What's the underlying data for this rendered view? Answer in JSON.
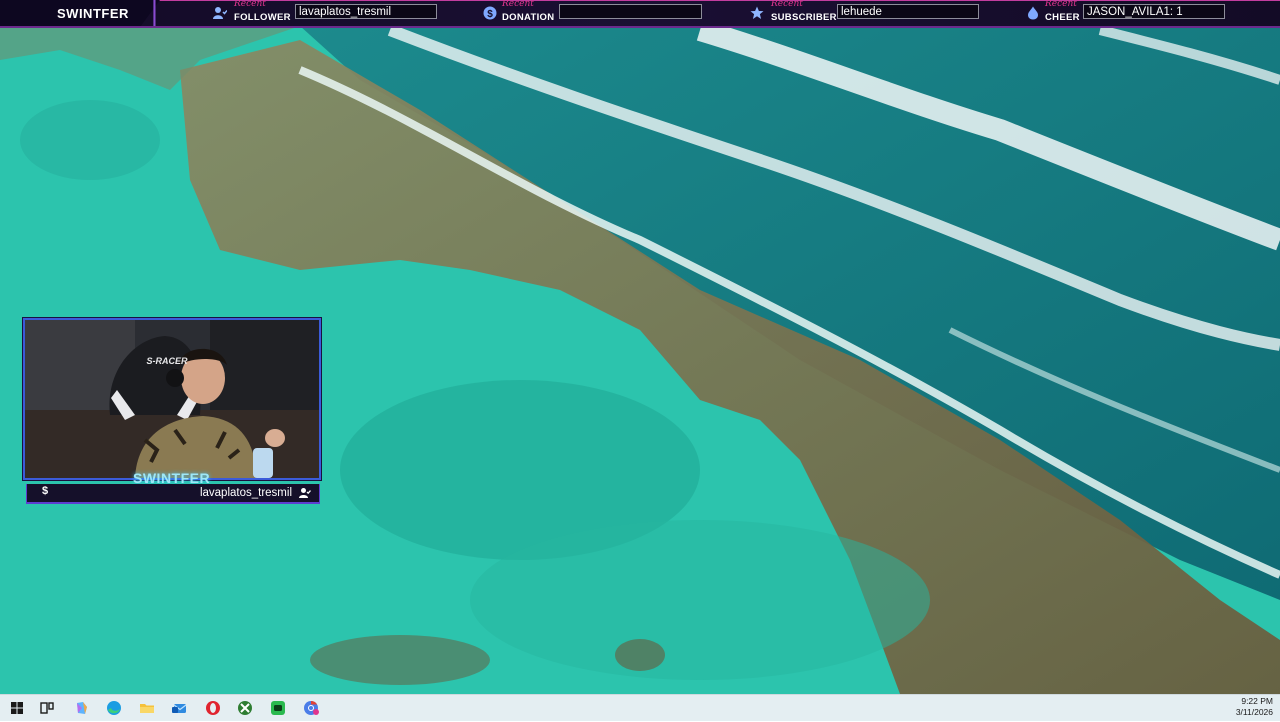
{
  "overlay": {
    "brand": "SWINTFER",
    "slots": {
      "follower": {
        "recent": "Recent",
        "kind": "FOLLOWER",
        "value": "lavaplatos_tresmil",
        "icon": "follower-icon"
      },
      "donation": {
        "recent": "Recent",
        "kind": "DONATION",
        "value": "",
        "icon": "dollar-icon"
      },
      "subscriber": {
        "recent": "Recent",
        "kind": "SUBSCRIBER",
        "value": "lehuede",
        "icon": "star-icon"
      },
      "cheer": {
        "recent": "Recent",
        "kind": "CHEER",
        "value": "JASON_AVILA1: 1",
        "icon": "diamond-icon"
      }
    },
    "accent_color": "#e0358e",
    "bar_color": "#130b26"
  },
  "webcam": {
    "name": "SWINTFER",
    "chair_brand": "S-RACER",
    "footer_dollar": "$",
    "footer_latest": "lavaplatos_tresmil",
    "frame_color": "#3b5bd9"
  },
  "taskbar": {
    "apps": [
      "windows-start-icon",
      "task-view-icon",
      "copilot-icon",
      "edge-icon",
      "file-explorer-icon",
      "mail-icon",
      "opera-icon",
      "xbox-icon",
      "whatsapp-icon",
      "chrome-icon"
    ],
    "time": "9:22 PM",
    "date": "3/11/2026"
  }
}
